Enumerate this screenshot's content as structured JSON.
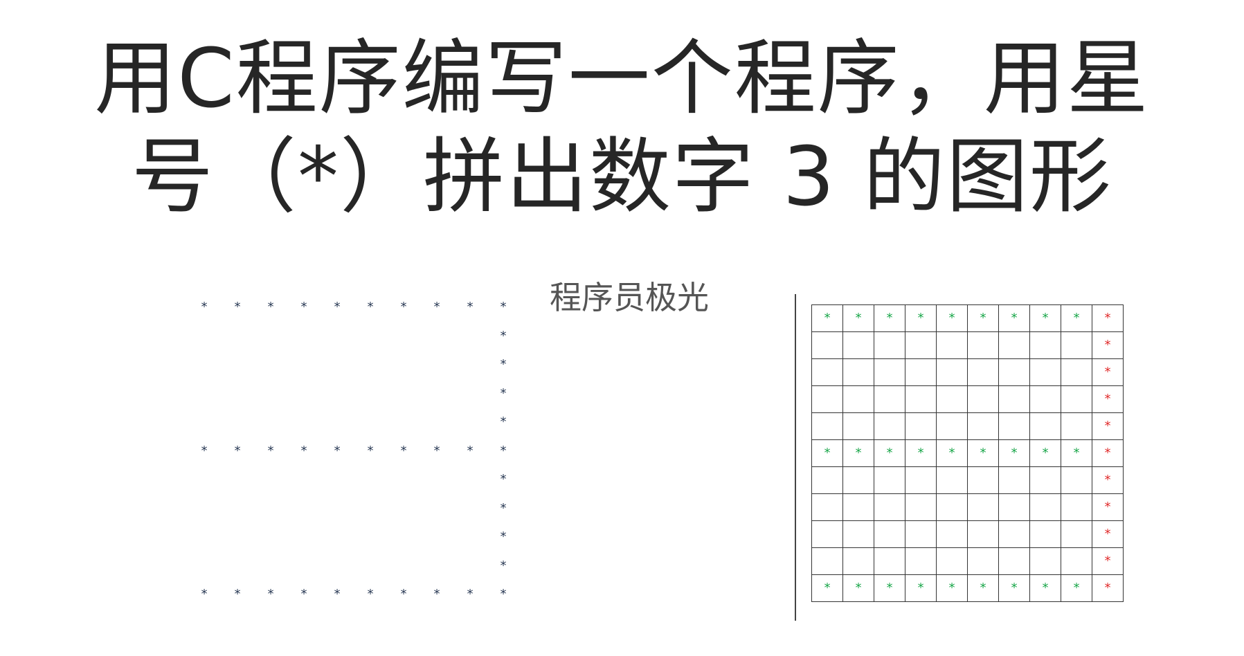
{
  "title": {
    "line1": "用C程序编写一个程序，用星",
    "line2": "号（*）拼出数字 3 的图形"
  },
  "watermark": "程序员极光",
  "star_figure": {
    "symbol": "*",
    "rows": [
      "**********",
      "         *",
      "         *",
      "         *",
      "         *",
      "**********",
      "         *",
      "         *",
      "         *",
      "         *",
      "**********"
    ],
    "color": "#2a3a55"
  },
  "grid": {
    "symbol": "*",
    "columns": 10,
    "rows": [
      "GGGGGGGGGR",
      "         R",
      "         R",
      "         R",
      "         R",
      "GGGGGGGGGR",
      "         R",
      "         R",
      "         R",
      "         R",
      "GGGGGGGGGR"
    ],
    "colors": {
      "green": "#1aa64a",
      "red": "#e02a2a",
      "border": "#333333"
    }
  }
}
